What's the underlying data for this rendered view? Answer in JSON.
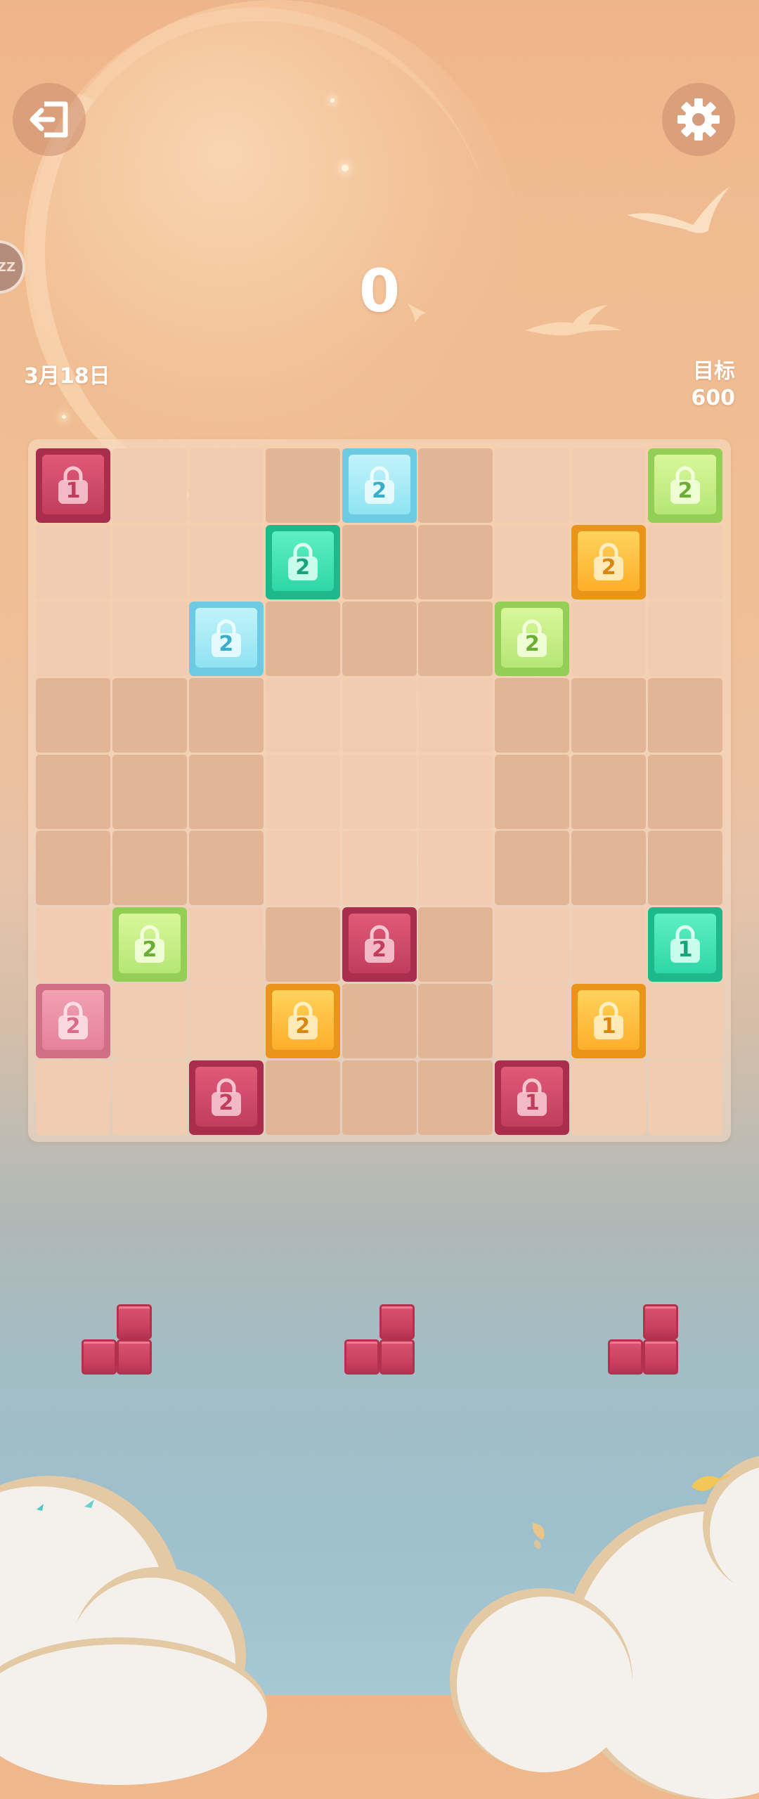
{
  "header": {
    "score": "0",
    "date": "3月18日",
    "target_label": "目标",
    "target_value": "600",
    "exit_icon": "exit-icon",
    "settings_icon": "gear-icon",
    "sleep_indicator": "ZZ"
  },
  "board": {
    "size": 9,
    "tiles": [
      {
        "row": 0,
        "col": 0,
        "color": "red",
        "count": "1"
      },
      {
        "row": 0,
        "col": 4,
        "color": "cyan",
        "count": "2"
      },
      {
        "row": 0,
        "col": 8,
        "color": "lime",
        "count": "2"
      },
      {
        "row": 1,
        "col": 3,
        "color": "teal",
        "count": "2"
      },
      {
        "row": 1,
        "col": 7,
        "color": "orange",
        "count": "2"
      },
      {
        "row": 2,
        "col": 2,
        "color": "cyan",
        "count": "2"
      },
      {
        "row": 2,
        "col": 6,
        "color": "lime",
        "count": "2"
      },
      {
        "row": 6,
        "col": 1,
        "color": "lime",
        "count": "2"
      },
      {
        "row": 6,
        "col": 4,
        "color": "red",
        "count": "2"
      },
      {
        "row": 6,
        "col": 8,
        "color": "teal",
        "count": "1"
      },
      {
        "row": 7,
        "col": 0,
        "color": "pink",
        "count": "2"
      },
      {
        "row": 7,
        "col": 3,
        "color": "orange",
        "count": "2"
      },
      {
        "row": 7,
        "col": 7,
        "color": "orange",
        "count": "1"
      },
      {
        "row": 8,
        "col": 2,
        "color": "red",
        "count": "2"
      },
      {
        "row": 8,
        "col": 6,
        "color": "red",
        "count": "1"
      }
    ]
  },
  "tray": {
    "pieces": [
      {
        "shape": "L-corner",
        "color": "red"
      },
      {
        "shape": "L-corner",
        "color": "red"
      },
      {
        "shape": "L-corner",
        "color": "red"
      }
    ]
  },
  "palette": {
    "red": {
      "top": "#e05a78",
      "bottom": "#c23c5c",
      "border": "#a92d4c",
      "lock": "#f6c6d0",
      "num": "#c23c5c"
    },
    "pink": {
      "top": "#f2a0b2",
      "bottom": "#e58299",
      "border": "#d06f86",
      "lock": "#fde0e6",
      "num": "#d86c86"
    },
    "cyan": {
      "top": "#c2f3fb",
      "bottom": "#8fe3f2",
      "border": "#6ccbe0",
      "lock": "#eafcff",
      "num": "#3aaec8"
    },
    "lime": {
      "top": "#d8f79a",
      "bottom": "#b6e676",
      "border": "#93cf55",
      "lock": "#f3ffdc",
      "num": "#6aae34"
    },
    "teal": {
      "top": "#5ef0c4",
      "bottom": "#2fd6a6",
      "border": "#1fb88c",
      "lock": "#d8fff1",
      "num": "#19a37b"
    },
    "orange": {
      "top": "#ffd35c",
      "bottom": "#ffae2a",
      "border": "#ea951a",
      "lock": "#fff0c4",
      "num": "#d88714"
    }
  }
}
